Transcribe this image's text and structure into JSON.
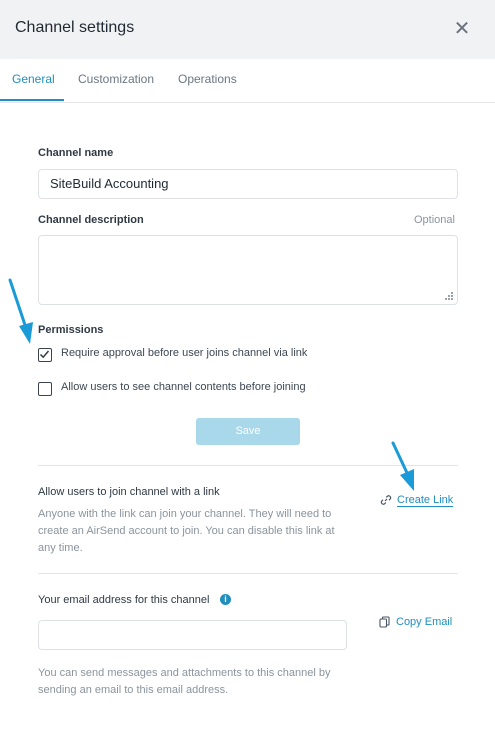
{
  "header": {
    "title": "Channel settings",
    "close_glyph": "✕"
  },
  "tabs": [
    {
      "label": "General",
      "active": true
    },
    {
      "label": "Customization",
      "active": false
    },
    {
      "label": "Operations",
      "active": false
    }
  ],
  "form": {
    "channel_name_label": "Channel name",
    "channel_name_value": "SiteBuild Accounting",
    "channel_description_label": "Channel description",
    "optional_label": "Optional",
    "channel_description_value": "",
    "permissions_label": "Permissions",
    "permissions": [
      {
        "label": "Require approval before user joins channel via link",
        "checked": true
      },
      {
        "label": "Allow users to see channel contents before joining",
        "checked": false
      }
    ],
    "save_label": "Save"
  },
  "join_link": {
    "title": "Allow users to join channel with a link",
    "description_lines": [
      "Anyone with the link can join your channel. They will need to",
      "create an AirSend account to join. You can disable this link at",
      "any time."
    ],
    "action_label": "Create Link",
    "action_icon": "link-icon"
  },
  "email": {
    "title": "Your email address for this channel",
    "info_icon": "info-icon",
    "info_glyph": "i",
    "value": "",
    "action_label": "Copy Email",
    "action_icon": "copy-icon",
    "help_lines": [
      "You can send messages and attachments to this channel by",
      "sending an email to this email address."
    ]
  },
  "colors": {
    "accent": "#1f8fbf",
    "save_button_disabled": "#a8d8ea",
    "annotation_arrow": "#1a9bd7"
  }
}
